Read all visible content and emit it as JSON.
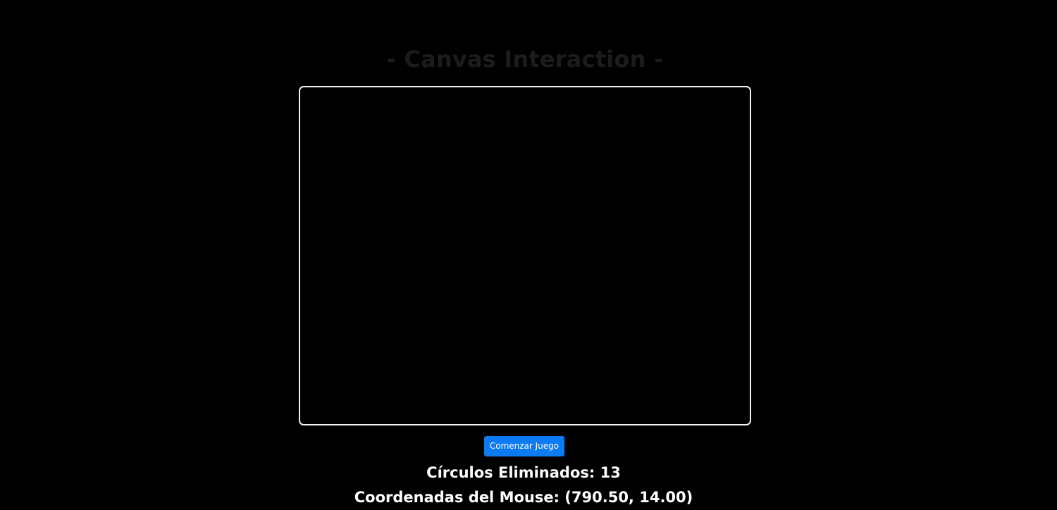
{
  "header": {
    "title": "- Canvas Interaction -"
  },
  "game": {
    "start_button_label": "Comenzar Juego",
    "score_label": "Círculos Eliminados:",
    "score_value": "13",
    "coords_label": "Coordenadas del Mouse:",
    "coords_value": "(790.50, 14.00)"
  },
  "colors": {
    "background": "#000000",
    "title": "#1b1c1e",
    "canvas_border": "#f2f2f2",
    "button": "#0d7bf2",
    "text": "#ffffff"
  }
}
